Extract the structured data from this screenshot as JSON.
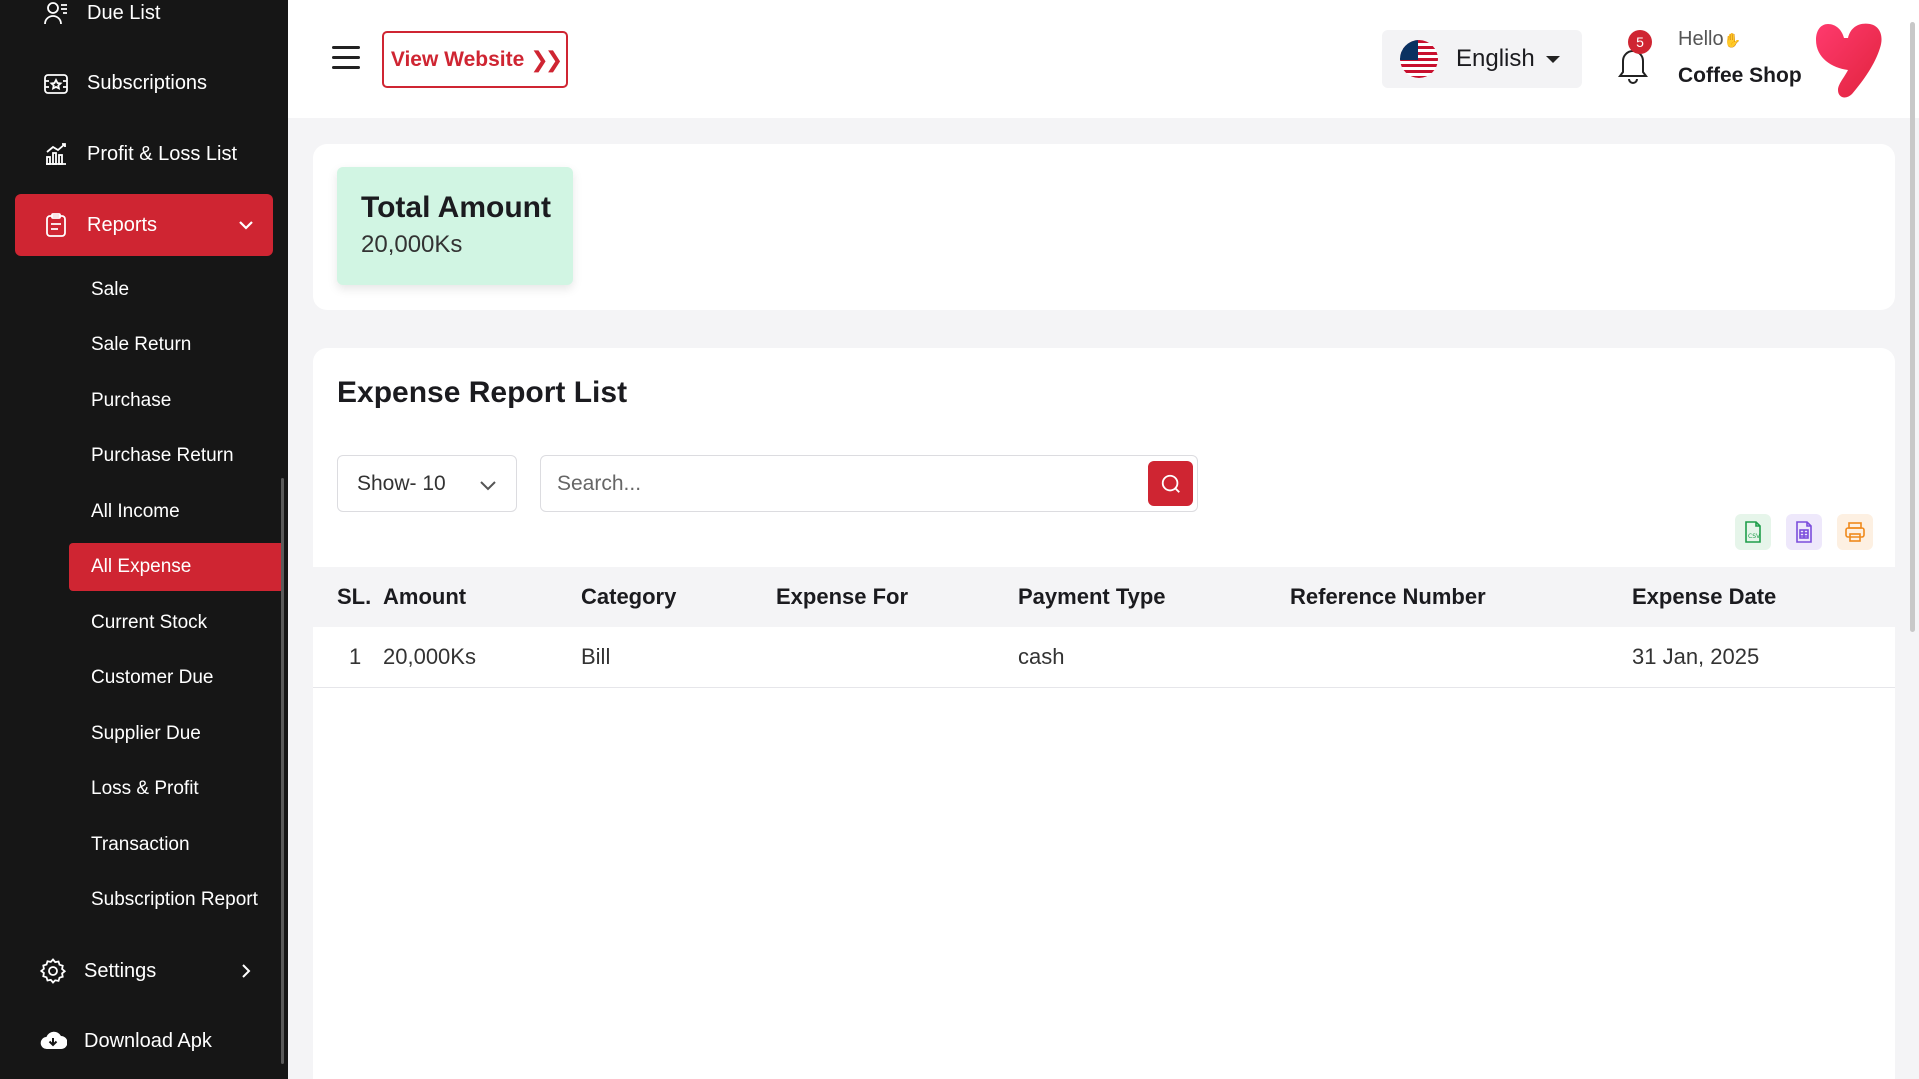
{
  "sidebar": {
    "items": [
      {
        "label": "Due List",
        "icon": "due-list-icon"
      },
      {
        "label": "Subscriptions",
        "icon": "subscriptions-icon"
      },
      {
        "label": "Profit & Loss List",
        "icon": "chart-icon"
      },
      {
        "label": "Reports",
        "icon": "clipboard-icon"
      },
      {
        "label": "Settings",
        "icon": "gear-icon"
      },
      {
        "label": "Download Apk",
        "icon": "cloud-download-icon"
      }
    ],
    "report_sub_items": [
      "Sale",
      "Sale Return",
      "Purchase",
      "Purchase Return",
      "All Income",
      "All Expense",
      "Current Stock",
      "Customer Due",
      "Supplier Due",
      "Loss & Profit",
      "Transaction",
      "Subscription Report"
    ]
  },
  "header": {
    "view_website": "View Website",
    "language": "English",
    "notification_count": "5",
    "greeting": "Hello",
    "user_name": "Coffee Shop"
  },
  "summary": {
    "title": "Total Amount",
    "value": "20,000Ks",
    "color": "#d1f5e3"
  },
  "report": {
    "title": "Expense Report List",
    "show_label": "Show- 10",
    "search_placeholder": "Search...",
    "columns": [
      "SL.",
      "Amount",
      "Category",
      "Expense For",
      "Payment Type",
      "Reference Number",
      "Expense Date"
    ],
    "rows": [
      {
        "sl": "1",
        "amount": "20,000Ks",
        "category": "Bill",
        "expense_for": "",
        "payment_type": "cash",
        "reference": "",
        "date": "31 Jan, 2025"
      }
    ]
  },
  "colors": {
    "accent": "#cf2532",
    "sidebar_bg": "#161616"
  }
}
